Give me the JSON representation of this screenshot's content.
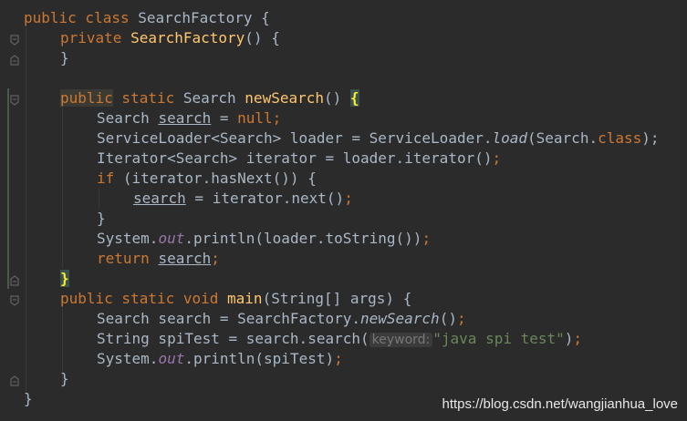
{
  "editor": {
    "lines": {
      "l1_a": "public",
      "l1_b": " class ",
      "l1_c": "SearchFactory {",
      "l2_a": "private ",
      "l2_b": "SearchFactory",
      "l2_c": "() {",
      "l3": "}",
      "l5_a": "public",
      "l5_b": " static ",
      "l5_c": "Search ",
      "l5_d": "newSearch",
      "l5_e": "() ",
      "l5_f": "{",
      "l6_a": "Search ",
      "l6_b": "search",
      "l6_c": " = ",
      "l6_d": "null",
      "l6_e": ";",
      "l7_a": "ServiceLoader<Search> loader = ServiceLoader.",
      "l7_b": "load",
      "l7_c": "(Search.",
      "l7_d": "class",
      "l7_e": ");",
      "l8_a": "Iterator<Search> iterator = loader.iterator()",
      "l8_b": ";",
      "l9_a": "if ",
      "l9_b": "(iterator.hasNext()) {",
      "l10_a": "search",
      "l10_b": " = iterator.next()",
      "l10_c": ";",
      "l11": "}",
      "l12_a": "System.",
      "l12_b": "out",
      "l12_c": ".println(loader.toString())",
      "l12_d": ";",
      "l13_a": "return ",
      "l13_b": "search",
      "l13_c": ";",
      "l14": "}",
      "l15_a": "public static void ",
      "l15_b": "main",
      "l15_c": "(String[] args) {",
      "l16_a": "Search search = SearchFactory.",
      "l16_b": "newSearch",
      "l16_c": "()",
      "l16_d": ";",
      "l17_a": "String spiTest = search.search(",
      "l17_hint": "keyword:",
      "l17_b": "\"java spi test\"",
      "l17_c": ")",
      "l17_d": ";",
      "l18_a": "System.",
      "l18_b": "out",
      "l18_c": ".println(spiTest)",
      "l18_d": ";",
      "l19": "}",
      "l20": "}"
    }
  },
  "watermark": "https://blog.csdn.net/wangjianhua_love",
  "colors": {
    "background": "#2b2b2b",
    "keyword": "#cc7832",
    "method": "#ffc66d",
    "static_field": "#9876aa",
    "string": "#6a8759",
    "text": "#a9b7c6"
  }
}
